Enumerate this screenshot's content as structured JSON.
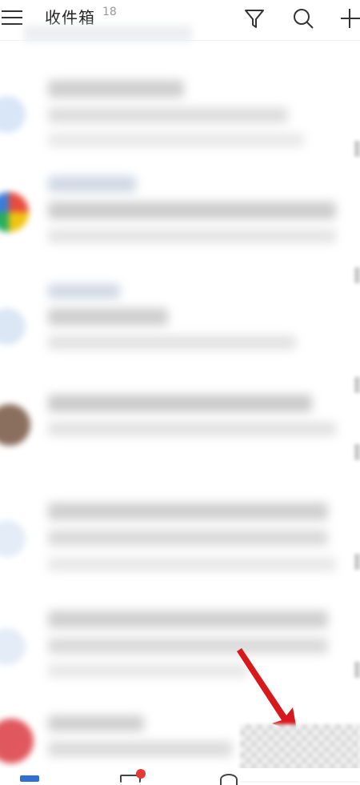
{
  "header": {
    "title": "收件箱",
    "count": "18",
    "icons": [
      "menu-icon",
      "filter-icon",
      "search-icon",
      "add-icon"
    ]
  },
  "colors": {
    "accent": "#2f6fd6",
    "badge": "#e53935",
    "arrow": "#d7191c"
  },
  "bottom_nav": {
    "icons": [
      "mail-icon",
      "calendar-icon",
      "contacts-icon"
    ],
    "active": "mail-icon"
  }
}
